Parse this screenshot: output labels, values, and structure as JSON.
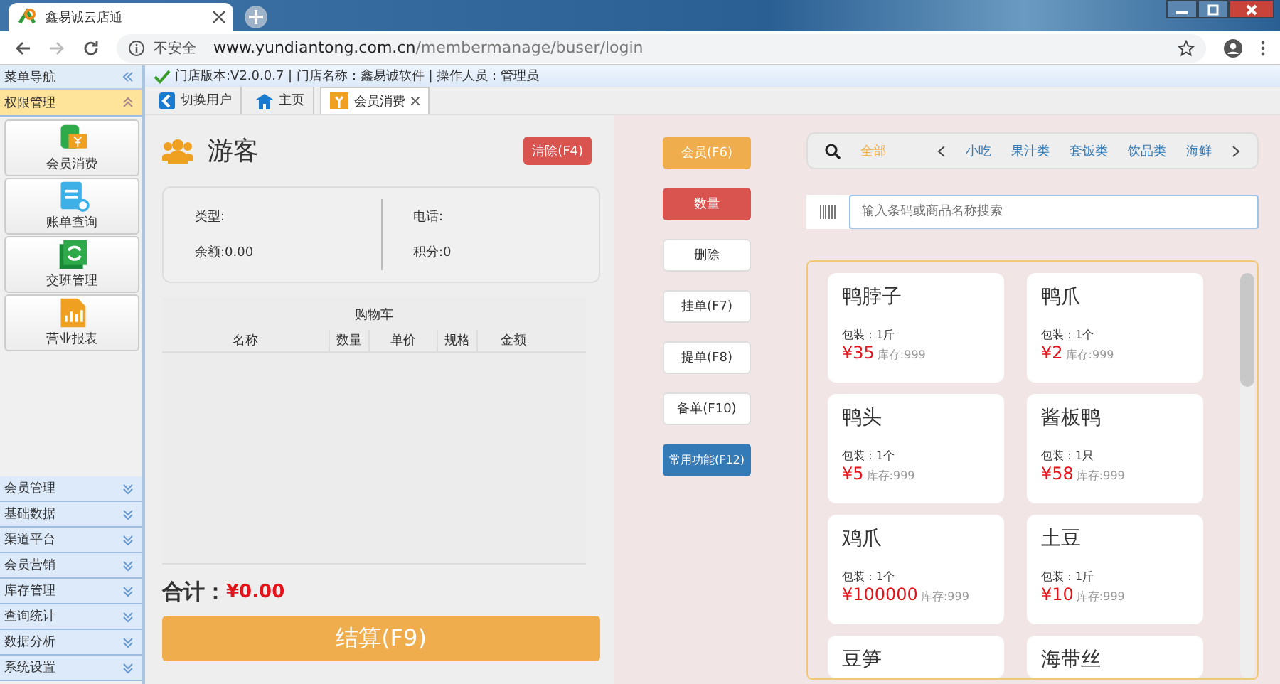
{
  "browser": {
    "tab_title": "鑫易诚云店通",
    "security": "不安全",
    "url_host": "www.yundiantong.com.cn",
    "url_path": "/membermanage/buser/login"
  },
  "sidebar": {
    "title": "菜单导航",
    "sections": [
      {
        "label": "权限管理",
        "expanded": true,
        "items": [
          {
            "label": "会员消费"
          },
          {
            "label": "账单查询"
          },
          {
            "label": "交班管理"
          },
          {
            "label": "营业报表"
          }
        ]
      },
      {
        "label": "会员管理",
        "expanded": false
      },
      {
        "label": "基础数据",
        "expanded": false
      },
      {
        "label": "渠道平台",
        "expanded": false
      },
      {
        "label": "会员营销",
        "expanded": false
      },
      {
        "label": "库存管理",
        "expanded": false
      },
      {
        "label": "查询统计",
        "expanded": false
      },
      {
        "label": "数据分析",
        "expanded": false
      },
      {
        "label": "系统设置",
        "expanded": false
      }
    ]
  },
  "info_bar": "门店版本:V2.0.0.7 | 门店名称：鑫易诚软件 | 操作人员：管理员",
  "tabs": [
    {
      "label": "切换用户",
      "selected": false
    },
    {
      "label": "主页",
      "selected": false
    },
    {
      "label": "会员消费",
      "selected": true
    }
  ],
  "customer": {
    "name": "游客",
    "clear_button": "清除(F4)",
    "fields": [
      {
        "label": "类型:"
      },
      {
        "label": "电话:"
      },
      {
        "label": "余额:0.00"
      },
      {
        "label": "积分:0"
      }
    ]
  },
  "cart": {
    "title": "购物车",
    "columns": [
      "名称",
      "数量",
      "单价",
      "规格",
      "金额"
    ]
  },
  "total": {
    "label": "合计：",
    "value": "¥0.00"
  },
  "settle_button": "结算(F9)",
  "actions": [
    {
      "label": "会员(F6)",
      "kind": "warning"
    },
    {
      "label": "数量",
      "kind": "danger"
    },
    {
      "label": "删除",
      "kind": "plain"
    },
    {
      "label": "挂单(F7)",
      "kind": "plain"
    },
    {
      "label": "提单(F8)",
      "kind": "plain"
    },
    {
      "label": "备单(F10)",
      "kind": "plain"
    },
    {
      "label": "常用功能(F12)",
      "kind": "primary"
    }
  ],
  "categories": [
    {
      "label": "全部",
      "selected": true
    },
    {
      "label": "小吃",
      "selected": false
    },
    {
      "label": "果汁类",
      "selected": false
    },
    {
      "label": "套饭类",
      "selected": false
    },
    {
      "label": "饮品类",
      "selected": false
    },
    {
      "label": "海鲜",
      "selected": false
    }
  ],
  "search": {
    "placeholder": "输入条码或商品名称搜索"
  },
  "products": [
    {
      "name": "鸭脖子",
      "package": "包装：1斤",
      "price": "¥35",
      "stock": "库存:999"
    },
    {
      "name": "鸭爪",
      "package": "包装：1个",
      "price": "¥2",
      "stock": "库存:999"
    },
    {
      "name": "鸭头",
      "package": "包装：1个",
      "price": "¥5",
      "stock": "库存:999"
    },
    {
      "name": "酱板鸭",
      "package": "包装：1只",
      "price": "¥58",
      "stock": "库存:999"
    },
    {
      "name": "鸡爪",
      "package": "包装：1个",
      "price": "¥100000",
      "stock": "库存:999"
    },
    {
      "name": "土豆",
      "package": "包装：1斤",
      "price": "¥10",
      "stock": "库存:999"
    },
    {
      "name": "豆笋"
    },
    {
      "name": "海带丝"
    }
  ]
}
